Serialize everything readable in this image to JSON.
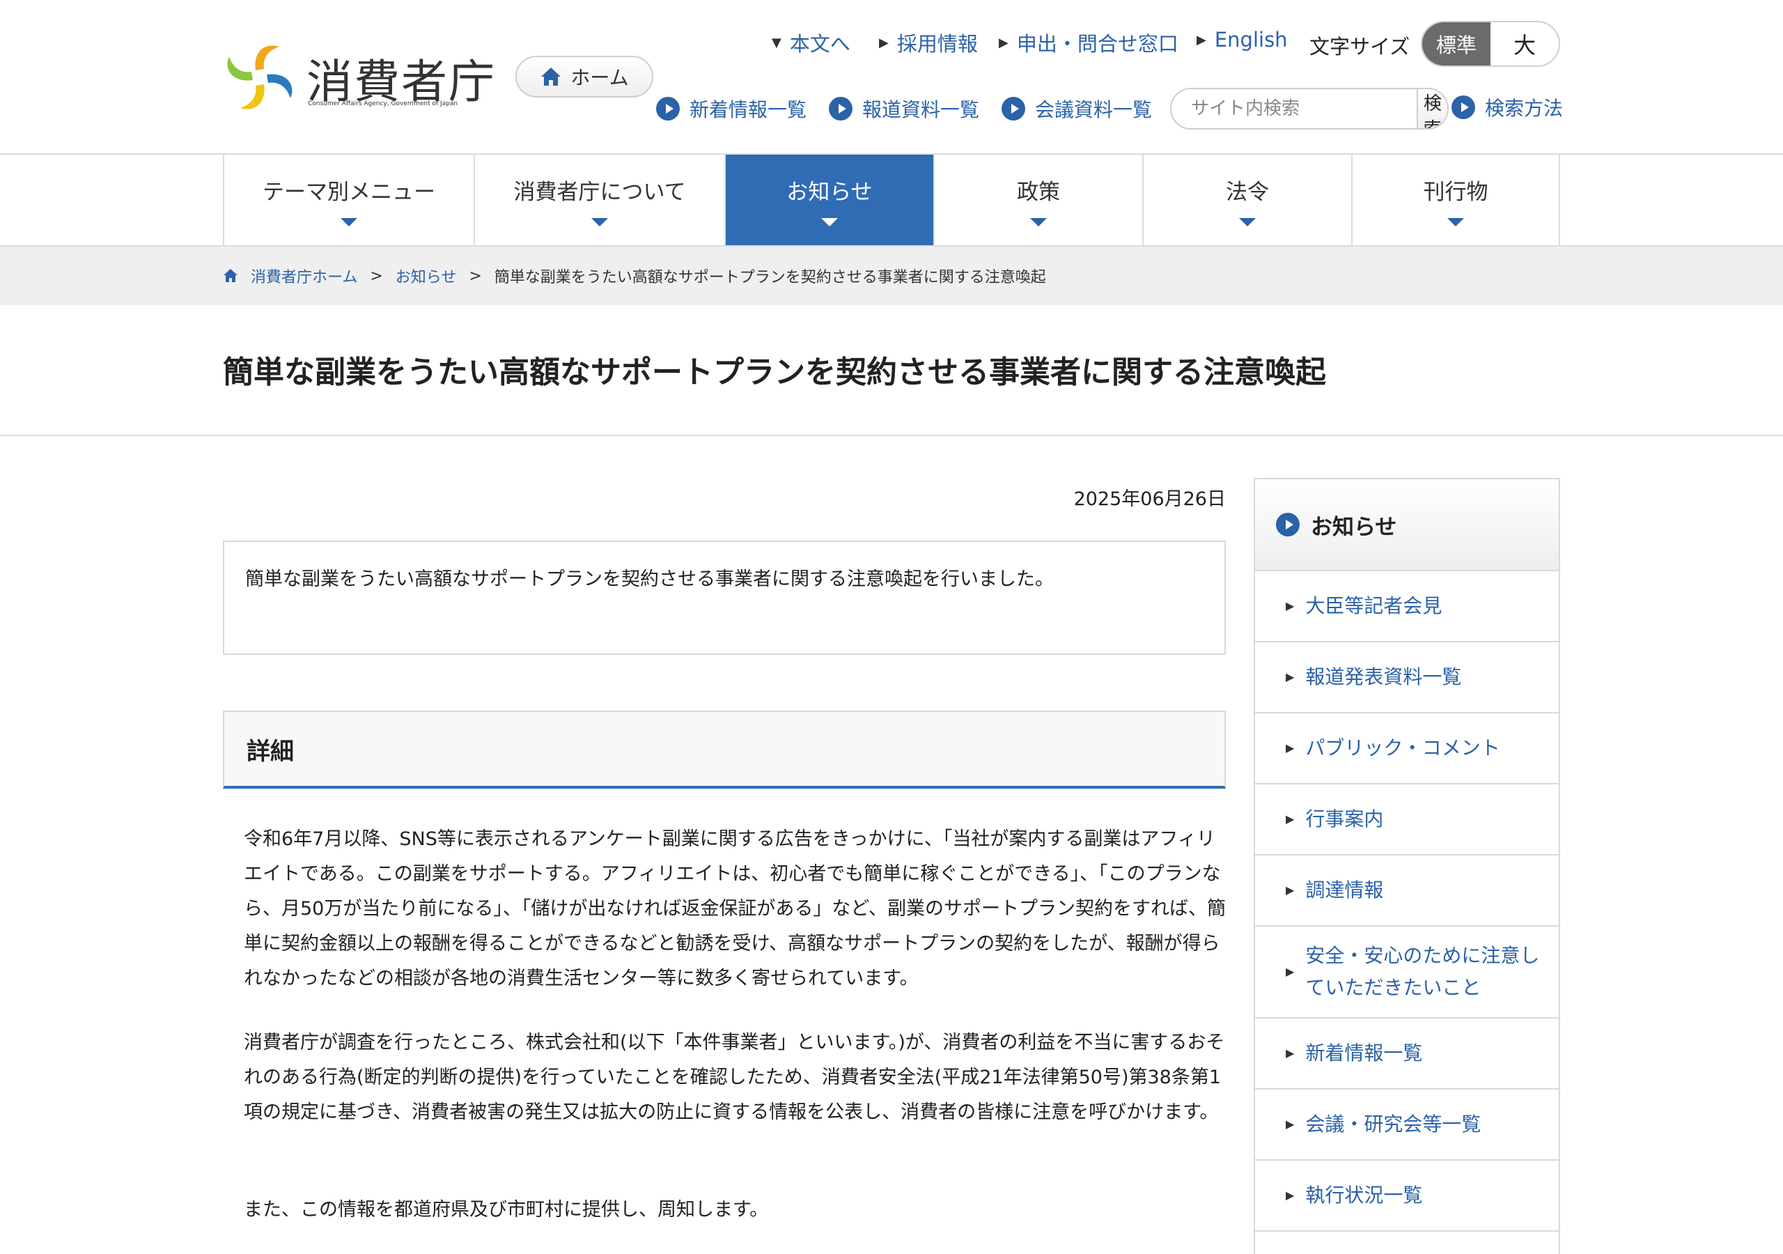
{
  "header": {
    "logo_text": "消費者庁",
    "logo_sub": "Consumer Affairs Agency, Government of Japan",
    "home_label": "ホーム",
    "top_links": [
      "本文へ",
      "採用情報",
      "申出・問合せ窓口",
      "English"
    ],
    "font_size_label": "文字サイズ",
    "font_size_normal": "標準",
    "font_size_large": "大",
    "sub_links": [
      "新着情報一覧",
      "報道資料一覧",
      "会議資料一覧"
    ],
    "search_placeholder": "サイト内検索",
    "search_button": "検索",
    "search_help": "検索方法"
  },
  "nav": {
    "items": [
      "テーマ別メニュー",
      "消費者庁について",
      "お知らせ",
      "政策",
      "法令",
      "刊行物"
    ],
    "active": "お知らせ"
  },
  "breadcrumb": [
    "消費者庁ホーム",
    "お知らせ",
    "簡単な副業をうたい高額なサポートプランを契約させる事業者に関する注意喚起"
  ],
  "page": {
    "title": "簡単な副業をうたい高額なサポートプランを契約させる事業者に関する注意喚起",
    "date": "2025年06月26日",
    "summary": "簡単な副業をうたい高額なサポートプランを契約させる事業者に関する注意喚起を行いました。",
    "detail_heading": "詳細",
    "paragraphs": [
      "令和6年7月以降、SNS等に表示されるアンケート副業に関する広告をきっかけに、「当社が案内する副業はアフィリエイトである。この副業をサポートする。アフィリエイトは、初心者でも簡単に稼ぐことができる」、「このプランなら、月50万が当たり前になる」、「儲けが出なければ返金保証がある」など、副業のサポートプラン契約をすれば、簡単に契約金額以上の報酬を得ることができるなどと勧誘を受け、高額なサポートプランの契約をしたが、報酬が得られなかったなどの相談が各地の消費生活センター等に数多く寄せられています。",
      "消費者庁が調査を行ったところ、株式会社和(以下「本件事業者」といいます。)が、消費者の利益を不当に害するおそれのある行為(断定的判断の提供)を行っていたことを確認したため、消費者安全法(平成21年法律第50号)第38条第1項の規定に基づき、消費者被害の発生又は拡大の防止に資する情報を公表し、消費者の皆様に注意を呼びかけます。",
      "また、この情報を都道府県及び市町村に提供し、周知します。"
    ]
  },
  "sidebar": {
    "heading": "お知らせ",
    "items": [
      "大臣等記者会見",
      "報道発表資料一覧",
      "パブリック・コメント",
      "行事案内",
      "調達情報",
      "安全・安心のために注意していただきたいこと",
      "新着情報一覧",
      "会議・研究会等一覧",
      "執行状況一覧"
    ]
  },
  "colors": {
    "accent": "#2f6cb4",
    "link": "#2b62a8",
    "breadcrumb_bg": "#efefef"
  }
}
